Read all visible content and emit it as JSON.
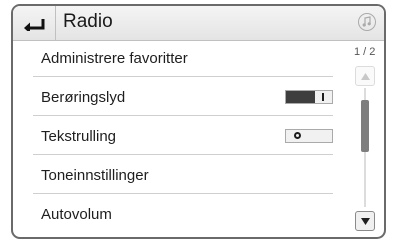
{
  "header": {
    "title": "Radio",
    "back_icon": "back-arrow-icon",
    "audio_icon": "music-note-icon"
  },
  "menu": {
    "items": [
      {
        "label": "Administrere favoritter"
      },
      {
        "label": "Berøringslyd",
        "toggle": "on"
      },
      {
        "label": "Tekstrulling",
        "toggle": "off"
      },
      {
        "label": "Toneinnstillinger"
      },
      {
        "label": "Autovolum"
      }
    ]
  },
  "scroll": {
    "page_indicator": "1 / 2",
    "up_icon": "chevron-up-icon",
    "down_icon": "chevron-down-icon"
  },
  "colors": {
    "frame": "#6a6a6a",
    "toggle_on": "#3e3e3e",
    "thumb": "#7e7e7e"
  }
}
